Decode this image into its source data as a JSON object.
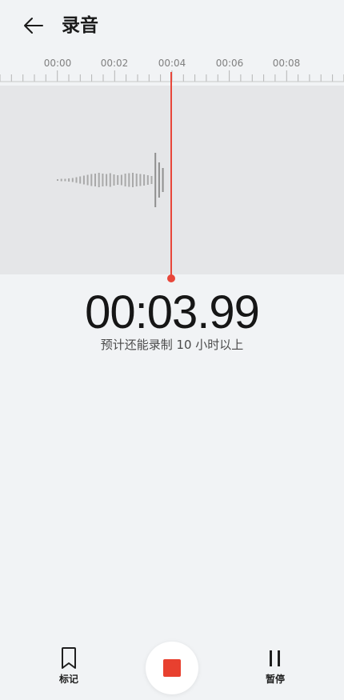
{
  "header": {
    "title": "录音",
    "back_icon": "arrow-left-icon"
  },
  "timeline": {
    "labels": [
      "00:00",
      "00:02",
      "00:04",
      "00:06",
      "00:08"
    ]
  },
  "recording": {
    "elapsed": "00:03.99",
    "remaining_text": "预计还能录制 10 小时以上"
  },
  "controls": {
    "mark_label": "标记",
    "mark_icon": "bookmark-icon",
    "stop_icon": "stop-icon",
    "pause_label": "暂停",
    "pause_icon": "pause-icon"
  },
  "colors": {
    "accent": "#e8463a",
    "background": "#f1f3f5",
    "waveform_bg": "#e5e6e8"
  }
}
